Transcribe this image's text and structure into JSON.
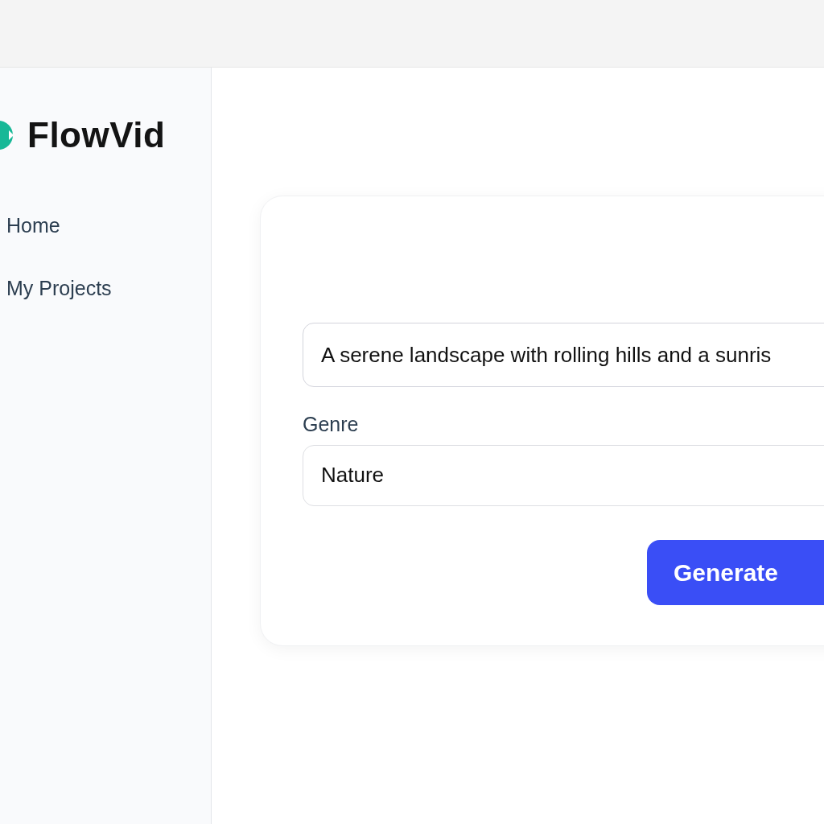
{
  "app": {
    "name": "FlowVid"
  },
  "sidebar": {
    "items": [
      {
        "label": "Home"
      },
      {
        "label": "My Projects"
      }
    ]
  },
  "form": {
    "prompt": {
      "value": "A serene landscape with rolling hills and a sunris"
    },
    "genre": {
      "label": "Genre",
      "value": "Nature"
    },
    "submit": "Generate"
  }
}
